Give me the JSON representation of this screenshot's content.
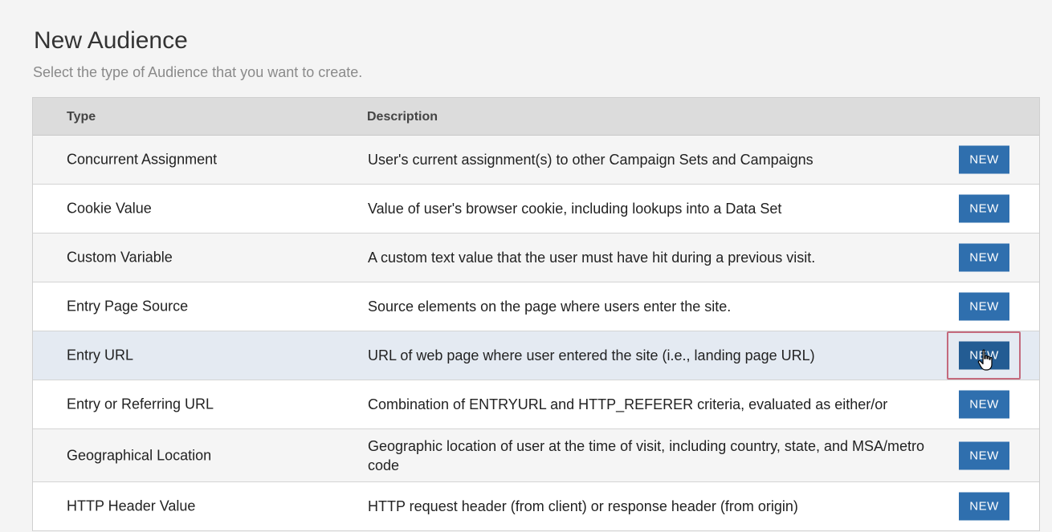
{
  "page": {
    "title": "New Audience",
    "subtitle": "Select the type of Audience that you want to create."
  },
  "table": {
    "headers": {
      "type": "Type",
      "description": "Description"
    },
    "rows": [
      {
        "type": "Concurrent Assignment",
        "description": "User's current assignment(s) to other Campaign Sets and Campaigns",
        "action": "NEW"
      },
      {
        "type": "Cookie Value",
        "description": "Value of user's browser cookie, including lookups into a Data Set",
        "action": "NEW"
      },
      {
        "type": "Custom Variable",
        "description": "A custom text value that the user must have hit during a previous visit.",
        "action": "NEW"
      },
      {
        "type": "Entry Page Source",
        "description": "Source elements on the page where users enter the site.",
        "action": "NEW"
      },
      {
        "type": "Entry URL",
        "description": "URL of web page where user entered the site (i.e., landing page URL)",
        "action": "NEW"
      },
      {
        "type": "Entry or Referring URL",
        "description": "Combination of ENTRYURL and HTTP_REFERER criteria, evaluated as either/or",
        "action": "NEW"
      },
      {
        "type": "Geographical Location",
        "description": "Geographic location of user at the time of visit, including country, state, and MSA/metro code",
        "action": "NEW"
      },
      {
        "type": "HTTP Header Value",
        "description": "HTTP request header (from client) or response header (from origin)",
        "action": "NEW"
      }
    ]
  },
  "colors": {
    "button": "#2f6fae",
    "highlight_row": "#e4eaf2",
    "focus_outline": "#c46a7d"
  },
  "cursor": {
    "icon": "hand-pointer-icon"
  }
}
